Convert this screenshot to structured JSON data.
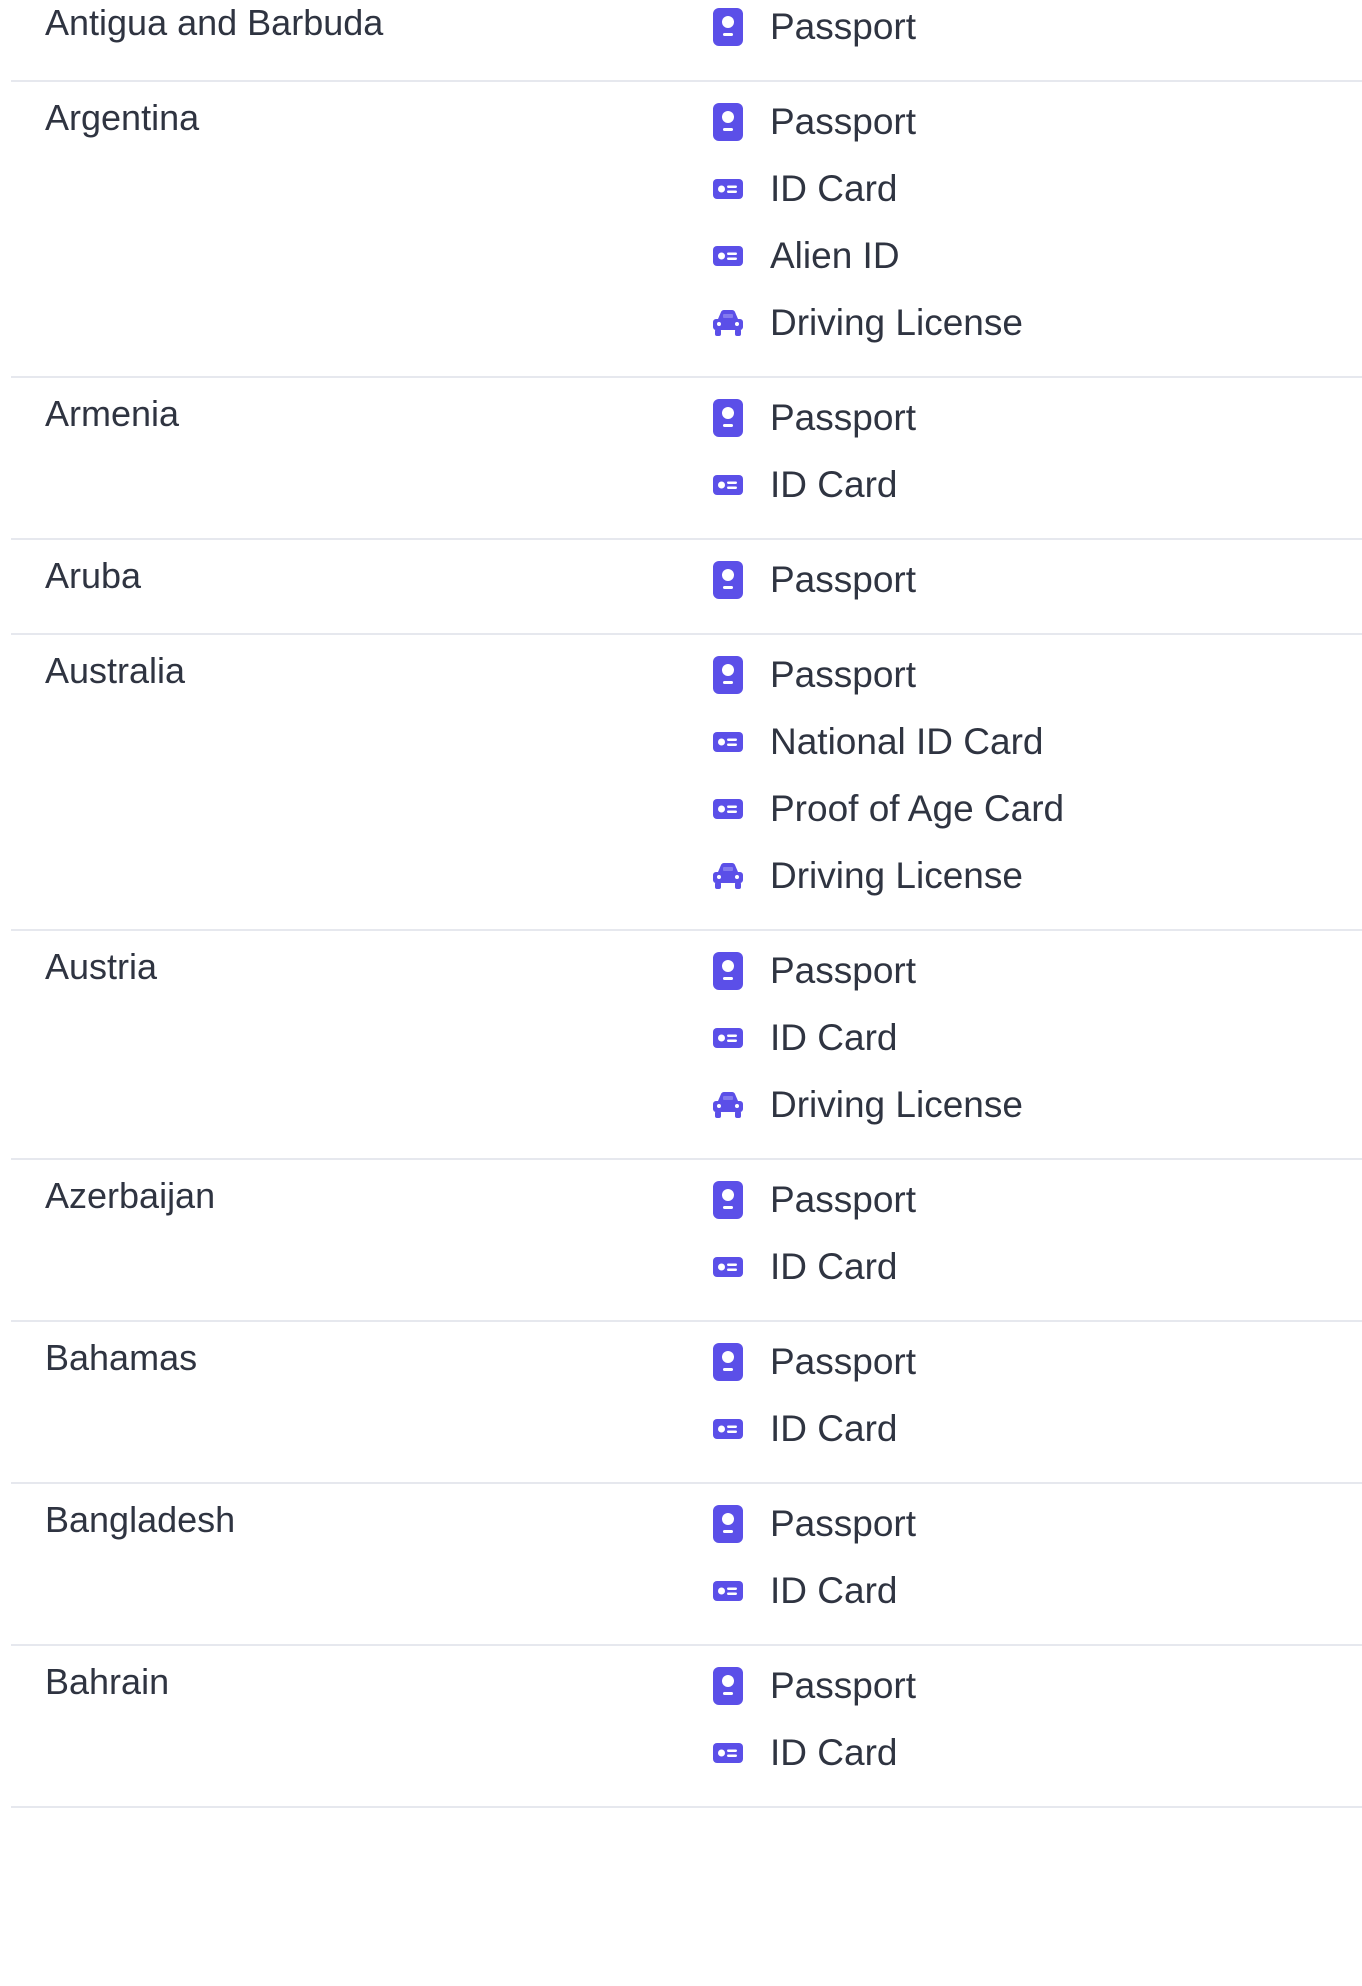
{
  "accent_color": "#5b4fe8",
  "rows": [
    {
      "country": "Antigua and Barbuda",
      "documents": [
        {
          "label": "Passport",
          "icon": "passport-icon"
        }
      ]
    },
    {
      "country": "Argentina",
      "documents": [
        {
          "label": "Passport",
          "icon": "passport-icon"
        },
        {
          "label": "ID Card",
          "icon": "id-card-icon"
        },
        {
          "label": "Alien ID",
          "icon": "id-card-icon"
        },
        {
          "label": "Driving License",
          "icon": "car-icon"
        }
      ]
    },
    {
      "country": "Armenia",
      "documents": [
        {
          "label": "Passport",
          "icon": "passport-icon"
        },
        {
          "label": "ID Card",
          "icon": "id-card-icon"
        }
      ]
    },
    {
      "country": "Aruba",
      "documents": [
        {
          "label": "Passport",
          "icon": "passport-icon"
        }
      ]
    },
    {
      "country": "Australia",
      "documents": [
        {
          "label": "Passport",
          "icon": "passport-icon"
        },
        {
          "label": "National ID Card",
          "icon": "id-card-icon"
        },
        {
          "label": "Proof of Age Card",
          "icon": "id-card-icon"
        },
        {
          "label": "Driving License",
          "icon": "car-icon"
        }
      ]
    },
    {
      "country": "Austria",
      "documents": [
        {
          "label": "Passport",
          "icon": "passport-icon"
        },
        {
          "label": "ID Card",
          "icon": "id-card-icon"
        },
        {
          "label": "Driving License",
          "icon": "car-icon"
        }
      ]
    },
    {
      "country": "Azerbaijan",
      "documents": [
        {
          "label": "Passport",
          "icon": "passport-icon"
        },
        {
          "label": "ID Card",
          "icon": "id-card-icon"
        }
      ]
    },
    {
      "country": "Bahamas",
      "documents": [
        {
          "label": "Passport",
          "icon": "passport-icon"
        },
        {
          "label": "ID Card",
          "icon": "id-card-icon"
        }
      ]
    },
    {
      "country": "Bangladesh",
      "documents": [
        {
          "label": "Passport",
          "icon": "passport-icon"
        },
        {
          "label": "ID Card",
          "icon": "id-card-icon"
        }
      ]
    },
    {
      "country": "Bahrain",
      "documents": [
        {
          "label": "Passport",
          "icon": "passport-icon"
        },
        {
          "label": "ID Card",
          "icon": "id-card-icon"
        }
      ]
    }
  ]
}
